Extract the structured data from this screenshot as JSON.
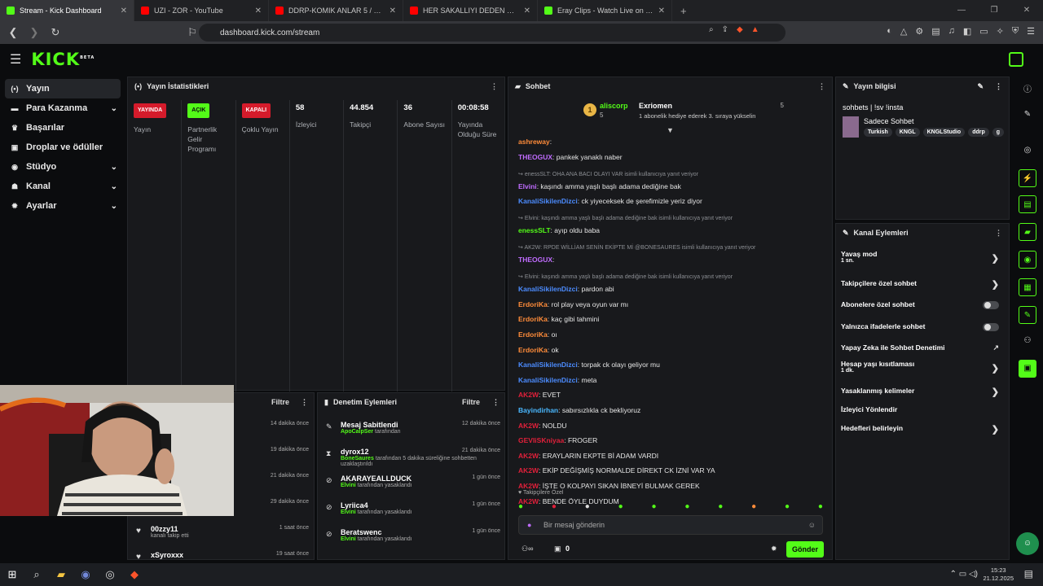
{
  "browser": {
    "tabs": [
      {
        "title": "Stream - Kick Dashboard",
        "color": "#53fc18",
        "active": true
      },
      {
        "title": "UZI - ZOR - YouTube",
        "color": "#ff0000",
        "active": false
      },
      {
        "title": "DDRP-KOMIK ANLAR 5 / EDITLI - You",
        "color": "#ff0000",
        "active": false
      },
      {
        "title": "HER SAKALLIYI DEDEN SANMA | SSn",
        "color": "#ff0000",
        "active": false
      },
      {
        "title": "Eray Clips - Watch Live on Kick",
        "color": "#53fc18",
        "active": false
      }
    ],
    "url": "dashboard.kick.com/stream"
  },
  "app": {
    "logo": "KICK",
    "logo_sup": "BETA"
  },
  "sidebar": {
    "items": [
      {
        "label": "Yayın",
        "icon": "broadcast-icon",
        "glyph": "(•)",
        "chevron": false,
        "active": true
      },
      {
        "label": "Para Kazanma",
        "icon": "money-icon",
        "glyph": "▬",
        "chevron": true,
        "active": false
      },
      {
        "label": "Başarılar",
        "icon": "trophy-icon",
        "glyph": "♛",
        "chevron": false,
        "active": false
      },
      {
        "label": "Droplar ve ödüller",
        "icon": "gift-icon",
        "glyph": "▣",
        "chevron": false,
        "active": false
      },
      {
        "label": "Stüdyo",
        "icon": "studio-icon",
        "glyph": "◉",
        "chevron": true,
        "active": false
      },
      {
        "label": "Kanal",
        "icon": "channel-icon",
        "glyph": "☗",
        "chevron": true,
        "active": false
      },
      {
        "label": "Ayarlar",
        "icon": "gear-icon",
        "glyph": "✹",
        "chevron": true,
        "active": false
      }
    ]
  },
  "stats": {
    "title": "Yayın İstatistikleri",
    "columns": [
      {
        "type": "badge",
        "value": "YAYINDA",
        "color": "#d51b2b",
        "label": "Yayın"
      },
      {
        "type": "badge",
        "value": "AÇIK",
        "color": "#53fc18",
        "label": "Partnerlik Gelir Programı"
      },
      {
        "type": "badge",
        "value": "KAPALI",
        "color": "#d51b2b",
        "label": "Çoklu Yayın"
      },
      {
        "type": "num",
        "value": "58",
        "label": "İzleyici"
      },
      {
        "type": "num",
        "value": "44.854",
        "label": "Takipçi"
      },
      {
        "type": "num",
        "value": "36",
        "label": "Abone Sayısı"
      },
      {
        "type": "num",
        "value": "00:08:58",
        "label": "Yayında Olduğu Süre"
      }
    ]
  },
  "activity": {
    "filter": "Filtre",
    "rows": [
      {
        "who": "",
        "sub": "",
        "time": "14 dakika önce"
      },
      {
        "who": "",
        "sub": "",
        "time": "19 dakika önce"
      },
      {
        "who": "",
        "sub": "",
        "time": "21 dakika önce"
      },
      {
        "who": "",
        "sub": "",
        "time": "29 dakika önce"
      },
      {
        "who": "00zzy11",
        "sub": "kanalı takip etti",
        "time": "1 saat önce"
      },
      {
        "who": "xSyroxxx",
        "sub": "",
        "time": "19 saat önce"
      }
    ]
  },
  "moderation": {
    "title": "Denetim Eylemleri",
    "filter": "Filtre",
    "rows": [
      {
        "icon": "pin-icon",
        "glyph": "✎",
        "title": "Mesaj Sabitlendi",
        "actor": "ApoCalpSer",
        "desc": "tarafından",
        "time": "12 dakika önce"
      },
      {
        "icon": "timeout-icon",
        "glyph": "⧗",
        "title": "dyrox12",
        "actor": "BoneSaures",
        "desc": "tarafından 5 dakika süreliğine sohbetten uzaklaştırıldı",
        "time": "21 dakika önce"
      },
      {
        "icon": "ban-icon",
        "glyph": "⊘",
        "title": "AKARAYEALLDUCK",
        "actor": "Elvini",
        "desc": "tarafından yasaklandı",
        "time": "1 gün önce"
      },
      {
        "icon": "ban-icon",
        "glyph": "⊘",
        "title": "Lyriica4",
        "actor": "Elvini",
        "desc": "tarafından yasaklandı",
        "time": "1 gün önce"
      },
      {
        "icon": "ban-icon",
        "glyph": "⊘",
        "title": "Beratswenc",
        "actor": "Elvini",
        "desc": "tarafından yasaklandı",
        "time": "1 gün önce"
      }
    ]
  },
  "chat": {
    "title": "Sohbet",
    "pinned": {
      "user1": "aliscorp",
      "count1": "5",
      "user2": "Exriomen",
      "count2": "5",
      "text": "1 abonelik hediye ederek 3. sıraya yükselin"
    },
    "messages": [
      {
        "user": "ashreway",
        "color": "#ff8c3a",
        "text": "",
        "reply": false
      },
      {
        "user": "THEOGUX",
        "color": "#c06cff",
        "text": "pankek yanaklı naber",
        "reply": false
      },
      {
        "user": "",
        "color": "",
        "text": "enessSLT: OHA ANA BACI OLAYI VAR isimli kullanıcıya yanıt veriyor",
        "reply": true
      },
      {
        "user": "Elvini",
        "color": "#c06cff",
        "text": "kaşındı amma yaşlı başlı adama dediğine bak",
        "reply": false
      },
      {
        "user": "KanaliSikilenDizci",
        "color": "#4c8cff",
        "text": "ck yiyeceksek de şerefimizle yeriz diyor",
        "reply": false
      },
      {
        "user": "",
        "color": "",
        "text": "Elvini: kaşındı amma yaşlı başlı adama dediğine bak isimli kullanıcıya yanıt veriyor",
        "reply": true
      },
      {
        "user": "enessSLT",
        "color": "#53fc18",
        "text": "ayıp oldu baba",
        "reply": false
      },
      {
        "user": "",
        "color": "",
        "text": "AK2W: RPDE WİLLİAM SENİN EKİPTE Mİ @BONESAURES isimli kullanıcıya yanıt veriyor",
        "reply": true
      },
      {
        "user": "THEOGUX",
        "color": "#c06cff",
        "text": "",
        "reply": false
      },
      {
        "user": "",
        "color": "",
        "text": "Elvini: kaşındı amma yaşlı başlı adama dediğine bak isimli kullanıcıya yanıt veriyor",
        "reply": true
      },
      {
        "user": "KanaliSikilenDizci",
        "color": "#4c8cff",
        "text": "pardon abi",
        "reply": false
      },
      {
        "user": "ErdoriKa",
        "color": "#ff8c3a",
        "text": "rol play veya oyun var mı",
        "reply": false
      },
      {
        "user": "ErdoriKa",
        "color": "#ff8c3a",
        "text": "kaç gibi tahmini",
        "reply": false
      },
      {
        "user": "ErdoriKa",
        "color": "#ff8c3a",
        "text": "oı",
        "reply": false
      },
      {
        "user": "ErdoriKa",
        "color": "#ff8c3a",
        "text": "ok",
        "reply": false
      },
      {
        "user": "KanaliSikilenDizci",
        "color": "#4c8cff",
        "text": "torpak ck olayı geliyor mu",
        "reply": false
      },
      {
        "user": "KanaliSikilenDizci",
        "color": "#4c8cff",
        "text": "meta",
        "reply": false
      },
      {
        "user": "AK2W",
        "color": "#e0203a",
        "text": "EVET",
        "reply": false
      },
      {
        "user": "Bayindirhan",
        "color": "#4ab8ff",
        "text": "sabırsızlıkla ck bekliyoruz",
        "reply": false
      },
      {
        "user": "AK2W",
        "color": "#e0203a",
        "text": "NOLDU",
        "reply": false
      },
      {
        "user": "GEVIiSKniyaa",
        "color": "#e0203a",
        "text": "FROGER",
        "reply": false
      },
      {
        "user": "AK2W",
        "color": "#e0203a",
        "text": "ERAYLARIN EKPTE Bİ ADAM VARDI",
        "reply": false
      },
      {
        "user": "AK2W",
        "color": "#e0203a",
        "text": "EKİP DEĞİŞMİŞ NORMALDE DİREKT CK İZNİ VAR YA",
        "reply": false
      },
      {
        "user": "AK2W",
        "color": "#e0203a",
        "text": "İŞTE O KOLPAYI SIKAN İBNEYİ BULMAK GEREK",
        "reply": false
      },
      {
        "user": "AK2W",
        "color": "#e0203a",
        "text": "BENDE ÖYLE DUYDUM",
        "reply": false
      }
    ],
    "mode": "Takipçilere Özel",
    "placeholder": "Bir mesaj gönderin",
    "count": "0",
    "send": "Gönder"
  },
  "stream_info": {
    "title": "Yayın bilgisi",
    "stream_title": "sohbets | !sv !insta",
    "category": "Sadece Sohbet",
    "tags": [
      "Turkish",
      "KNGL",
      "KNGLStudio",
      "ddrp",
      "g"
    ]
  },
  "channel_actions": {
    "title": "Kanal Eylemleri",
    "rows": [
      {
        "label": "Yavaş mod",
        "sub": "1 sn.",
        "control": "chevron"
      },
      {
        "label": "Takipçilere özel sohbet",
        "sub": "",
        "control": "chevron"
      },
      {
        "label": "Abonelere özel sohbet",
        "sub": "",
        "control": "toggle"
      },
      {
        "label": "Yalnızca ifadelerle sohbet",
        "sub": "",
        "control": "toggle"
      },
      {
        "label": "Yapay Zeka ile Sohbet Denetimi",
        "sub": "",
        "control": "external"
      },
      {
        "label": "Hesap yaşı kısıtlaması",
        "sub": "1 dk.",
        "control": "chevron"
      },
      {
        "label": "Yasaklanmış kelimeler",
        "sub": "",
        "control": "chevron"
      },
      {
        "label": "İzleyici Yönlendir",
        "sub": "",
        "control": "none"
      },
      {
        "label": "Hedefleri belirleyin",
        "sub": "",
        "control": "chevron"
      }
    ]
  },
  "taskbar": {
    "time": "15:23",
    "date": "21.12.2025"
  }
}
